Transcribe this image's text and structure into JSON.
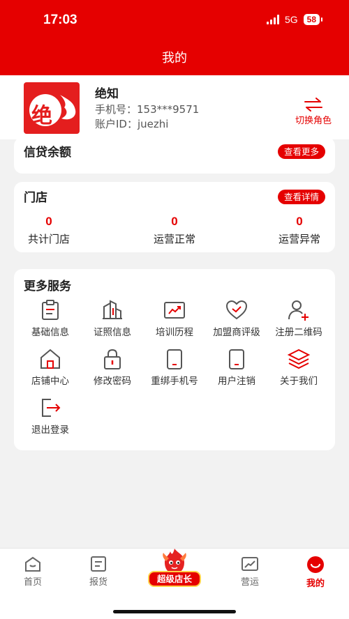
{
  "status_bar": {
    "time": "17:03",
    "network": "5G",
    "battery": "58"
  },
  "header": {
    "title": "我的"
  },
  "profile": {
    "name": "绝知",
    "phone": "手机号：153***9571",
    "account_id": "账户ID：juezhi",
    "switch_role_label": "切换角色",
    "avatar_icon": "juezhi-logo"
  },
  "credit_card": {
    "title": "信贷余额",
    "more_button": "查看更多"
  },
  "store_card": {
    "title": "门店",
    "detail_button": "查看详情",
    "stats": [
      {
        "value": "0",
        "label": "共计门店"
      },
      {
        "value": "0",
        "label": "运营正常"
      },
      {
        "value": "0",
        "label": "运营异常"
      }
    ]
  },
  "services": {
    "title": "更多服务",
    "items": [
      {
        "label": "基础信息",
        "icon": "clipboard-icon"
      },
      {
        "label": "证照信息",
        "icon": "buildings-icon"
      },
      {
        "label": "培训历程",
        "icon": "chart-board-icon"
      },
      {
        "label": "加盟商评级",
        "icon": "heart-icon"
      },
      {
        "label": "注册二维码",
        "icon": "add-user-icon"
      },
      {
        "label": "店铺中心",
        "icon": "home-icon"
      },
      {
        "label": "修改密码",
        "icon": "lock-icon"
      },
      {
        "label": "重绑手机号",
        "icon": "phone-icon"
      },
      {
        "label": "用户注销",
        "icon": "phone-icon"
      },
      {
        "label": "关于我们",
        "icon": "layers-icon"
      },
      {
        "label": "退出登录",
        "icon": "logout-icon"
      }
    ]
  },
  "tabbar": {
    "items": [
      {
        "label": "首页",
        "icon": "home-icon"
      },
      {
        "label": "报货",
        "icon": "document-icon"
      },
      {
        "label": "超级店长",
        "icon": "mascot-icon"
      },
      {
        "label": "营运",
        "icon": "trend-icon"
      },
      {
        "label": "我的",
        "icon": "smile-icon",
        "active": true
      }
    ]
  },
  "colors": {
    "brand_red": "#e50000",
    "background": "#f2f2f2"
  }
}
